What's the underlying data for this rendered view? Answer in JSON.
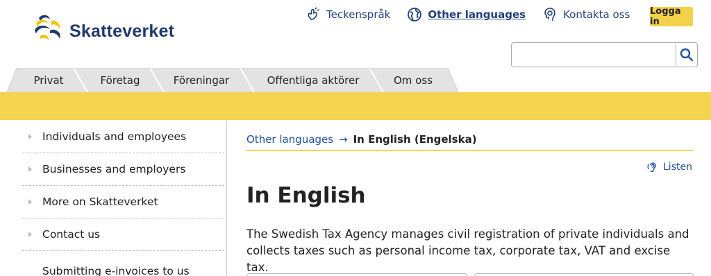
{
  "brand": {
    "name": "Skatteverket"
  },
  "header": {
    "links": [
      {
        "label": "Teckenspråk",
        "icon": "sign-language-icon"
      },
      {
        "label": "Other languages",
        "icon": "globe-icon"
      },
      {
        "label": "Kontakta oss",
        "icon": "contact-icon"
      }
    ],
    "login_label": "Logga in"
  },
  "search": {
    "value": "",
    "placeholder": ""
  },
  "nav": {
    "tabs": [
      "Privat",
      "Företag",
      "Föreningar",
      "Offentliga aktörer",
      "Om oss"
    ]
  },
  "sidebar": {
    "items": [
      "Individuals and employees",
      "Businesses and employers",
      "More on Skatteverket",
      "Contact us",
      "Submitting e-invoices to us"
    ]
  },
  "breadcrumb": {
    "parent": "Other languages",
    "separator": "→",
    "current": "In English (Engelska)"
  },
  "listen_label": "Listen",
  "main": {
    "title": "In English",
    "lead": "The Swedish Tax Agency manages civil registration of private individuals and collects taxes such as personal income tax, corporate tax, VAT and excise tax."
  },
  "colors": {
    "accent_yellow": "#f4d44e",
    "brand_blue": "#1f3a6d",
    "link_blue": "#1f4f99"
  }
}
